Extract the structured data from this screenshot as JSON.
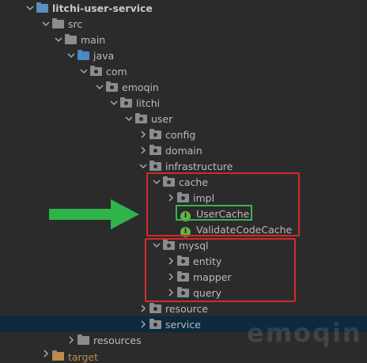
{
  "project_tree": {
    "items": [
      {
        "label": "litchi-user-service",
        "icon": "module-folder-icon",
        "expanded": true
      },
      {
        "label": "src",
        "icon": "folder-icon",
        "expanded": true
      },
      {
        "label": "main",
        "icon": "folder-icon",
        "expanded": true
      },
      {
        "label": "java",
        "icon": "source-root-folder-icon",
        "expanded": true
      },
      {
        "label": "com",
        "icon": "package-icon",
        "expanded": true
      },
      {
        "label": "emoqin",
        "icon": "package-icon",
        "expanded": true
      },
      {
        "label": "litchi",
        "icon": "package-icon",
        "expanded": true
      },
      {
        "label": "user",
        "icon": "package-icon",
        "expanded": true
      },
      {
        "label": "config",
        "icon": "package-icon",
        "expanded": false
      },
      {
        "label": "domain",
        "icon": "package-icon",
        "expanded": false
      },
      {
        "label": "infrastructure",
        "icon": "package-icon",
        "expanded": true
      },
      {
        "label": "cache",
        "icon": "package-icon",
        "expanded": true
      },
      {
        "label": "impl",
        "icon": "package-icon",
        "expanded": false
      },
      {
        "label": "UserCache",
        "icon": "interface-icon",
        "icon_letter": "I"
      },
      {
        "label": "ValidateCodeCache",
        "icon": "interface-icon",
        "icon_letter": "I"
      },
      {
        "label": "mysql",
        "icon": "package-icon",
        "expanded": true
      },
      {
        "label": "entity",
        "icon": "package-icon",
        "expanded": false
      },
      {
        "label": "mapper",
        "icon": "package-icon",
        "expanded": false
      },
      {
        "label": "query",
        "icon": "package-icon",
        "expanded": false
      },
      {
        "label": "resource",
        "icon": "package-icon",
        "expanded": false
      },
      {
        "label": "service",
        "icon": "package-icon",
        "expanded": false,
        "selected": true
      },
      {
        "label": "resources",
        "icon": "folder-icon",
        "expanded": false
      },
      {
        "label": "target",
        "icon": "folder-icon",
        "expanded": false
      }
    ]
  },
  "watermark": "emoqin",
  "colors": {
    "background": "#2b2b2b",
    "selection": "#0d293e",
    "annotation_red": "#d42a2a",
    "annotation_green": "#38b44a",
    "arrow_green": "#2fb34a",
    "interface_icon": "#62b543"
  }
}
